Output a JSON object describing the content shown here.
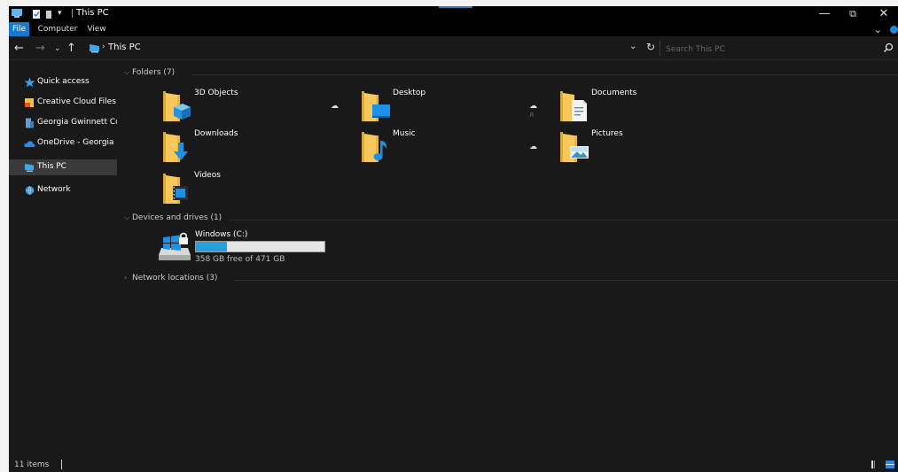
{
  "window": {
    "title": "This PC"
  },
  "ribbon": {
    "tabs": [
      {
        "label": "File"
      },
      {
        "label": "Computer"
      },
      {
        "label": "View"
      }
    ]
  },
  "address": {
    "path": "This PC"
  },
  "search": {
    "placeholder": "Search This PC"
  },
  "sidebar": {
    "items": [
      {
        "label": "Quick access"
      },
      {
        "label": "Creative Cloud Files"
      },
      {
        "label": "Georgia Gwinnett Col"
      },
      {
        "label": "OneDrive - Georgia G"
      },
      {
        "label": "This PC"
      },
      {
        "label": "Network"
      }
    ]
  },
  "groups": {
    "folders": {
      "label": "Folders (7)"
    },
    "devices": {
      "label": "Devices and drives (1)"
    },
    "network": {
      "label": "Network locations (3)"
    }
  },
  "folders": [
    {
      "name": "3D Objects",
      "icon": "3d-objects-folder-icon"
    },
    {
      "name": "Desktop",
      "icon": "desktop-folder-icon"
    },
    {
      "name": "Documents",
      "icon": "documents-folder-icon"
    },
    {
      "name": "Downloads",
      "icon": "downloads-folder-icon"
    },
    {
      "name": "Music",
      "icon": "music-folder-icon"
    },
    {
      "name": "Pictures",
      "icon": "pictures-folder-icon"
    },
    {
      "name": "Videos",
      "icon": "videos-folder-icon"
    }
  ],
  "drive": {
    "name": "Windows (C:)",
    "free_text": "358 GB free of 471 GB",
    "used_fraction": 0.24
  },
  "status": {
    "items_count": "11 items"
  },
  "colors": {
    "accent": "#1979ca",
    "background": "#191919",
    "selected": "#3a3a3a",
    "drive_bar": "#26a0da"
  }
}
